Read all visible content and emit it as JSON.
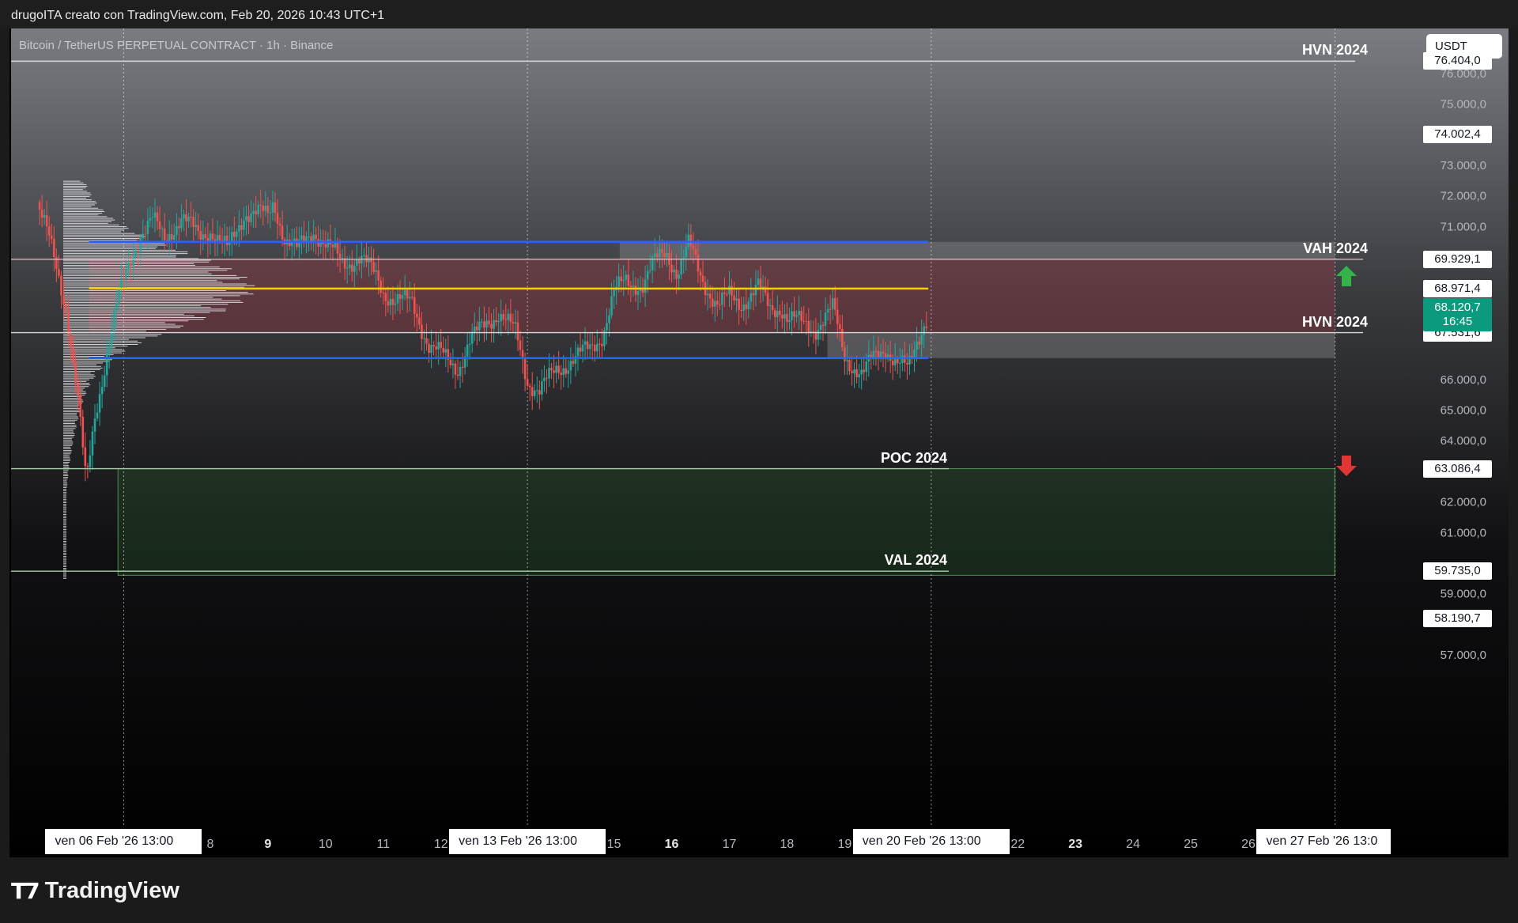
{
  "header": {
    "text": "drugoITA creato con TradingView.com, Feb 20, 2026 10:43 UTC+1"
  },
  "symbol": "Bitcoin / TetherUS PERPETUAL CONTRACT · 1h · Binance",
  "currency": "USDT",
  "brand": "TradingView",
  "colors": {
    "up": "#26a69a",
    "down": "#ef5350",
    "current": "#0c9a7e",
    "blue_line": "#2962ff",
    "yellow_line": "#f5d000",
    "arrow_up": "#34b34a",
    "arrow_down": "#e23636"
  },
  "chart_data": {
    "type": "candlestick",
    "timeframe": "1h",
    "ylim": [
      56000,
      77800
    ],
    "y_ticks": [
      "76.000,0",
      "75.000,0",
      "73.000,0",
      "72.000,0",
      "71.000,0",
      "66.000,0",
      "65.000,0",
      "64.000,0",
      "62.000,0",
      "61.000,0",
      "59.000,0",
      "57.000,0"
    ],
    "y_tick_values": [
      76000,
      75000,
      73000,
      72000,
      71000,
      66000,
      65000,
      64000,
      62000,
      61000,
      59000,
      57000
    ],
    "x_ticks": [
      {
        "label": "8",
        "day": 8
      },
      {
        "label": "9",
        "day": 9
      },
      {
        "label": "10",
        "day": 10
      },
      {
        "label": "11",
        "day": 11
      },
      {
        "label": "12",
        "day": 12
      },
      {
        "label": "15",
        "day": 15
      },
      {
        "label": "16",
        "day": 16
      },
      {
        "label": "17",
        "day": 17
      },
      {
        "label": "18",
        "day": 18
      },
      {
        "label": "19",
        "day": 19
      },
      {
        "label": "22",
        "day": 22
      },
      {
        "label": "23",
        "day": 23
      },
      {
        "label": "24",
        "day": 24
      },
      {
        "label": "25",
        "day": 25
      },
      {
        "label": "26",
        "day": 26
      }
    ],
    "x_date_labels": [
      {
        "text": "ven 06 Feb '26   13:00",
        "day": 6.5
      },
      {
        "text": "ven 13 Feb '26   13:00",
        "day": 13.5
      },
      {
        "text": "ven 20 Feb '26   13:00",
        "day": 20.5
      },
      {
        "text": "ven 27 Feb '26   13:0",
        "day": 27.5
      }
    ],
    "price_labels": [
      {
        "text": "76.404,0",
        "value": 76404
      },
      {
        "text": "74.002,4",
        "value": 74002.4
      },
      {
        "text": "69.929,1",
        "value": 69929.1
      },
      {
        "text": "68.971,4",
        "value": 68971.4
      },
      {
        "text": "67.531,6",
        "value": 67531.6
      },
      {
        "text": "63.086,4",
        "value": 63086.4
      },
      {
        "text": "59.735,0",
        "value": 59735
      },
      {
        "text": "58.190,7",
        "value": 58190.7
      }
    ],
    "current_price": {
      "price": "68.120,7",
      "countdown": "16:45",
      "value": 68120.7
    },
    "levels": [
      {
        "label": "HVN 2024",
        "value": 76404
      },
      {
        "label": "VAH 2024",
        "value": 69929.1
      },
      {
        "label": "HVN 2024",
        "value": 67531.6
      },
      {
        "label": "POC 2024",
        "value": 63086.4
      },
      {
        "label": "VAL 2024",
        "value": 59735
      }
    ],
    "day_range": [
      5.0,
      27.6
    ],
    "trend_lines": {
      "blue_top": 70500,
      "blue_bottom": 66700,
      "yellow": 68971.4,
      "blue_start_day": 5.9,
      "blue_end_day": 20.45
    },
    "zones": [
      {
        "type": "red",
        "from": 67531.6,
        "to": 69929.1,
        "start_day": 5.9,
        "end_day": 27.5
      },
      {
        "type": "gray",
        "from": 69929.1,
        "to": 70500,
        "start_day": 15.1,
        "end_day": 27.5
      },
      {
        "type": "gray",
        "from": 66700,
        "to": 67531.6,
        "start_day": 18.7,
        "end_day": 27.5
      },
      {
        "type": "green",
        "from": 59600,
        "to": 63086.4,
        "start_day": 6.4,
        "end_day": 27.5
      }
    ],
    "price_path": [
      [
        5.0,
        71800
      ],
      [
        5.2,
        70600
      ],
      [
        5.5,
        68400
      ],
      [
        5.7,
        65500
      ],
      [
        5.85,
        62500
      ],
      [
        6.0,
        64800
      ],
      [
        6.2,
        66800
      ],
      [
        6.4,
        68600
      ],
      [
        6.6,
        69800
      ],
      [
        6.8,
        70800
      ],
      [
        7.0,
        71200
      ],
      [
        7.2,
        70600
      ],
      [
        7.5,
        71300
      ],
      [
        7.8,
        70700
      ],
      [
        8.0,
        70900
      ],
      [
        8.3,
        70200
      ],
      [
        8.6,
        71500
      ],
      [
        8.9,
        71400
      ],
      [
        9.0,
        71300
      ],
      [
        9.1,
        71800
      ],
      [
        9.3,
        70600
      ],
      [
        9.5,
        70200
      ],
      [
        9.8,
        70900
      ],
      [
        10.0,
        70400
      ],
      [
        10.3,
        69800
      ],
      [
        10.6,
        70000
      ],
      [
        10.9,
        69300
      ],
      [
        11.0,
        68900
      ],
      [
        11.2,
        68600
      ],
      [
        11.5,
        68500
      ],
      [
        11.8,
        67100
      ],
      [
        12.0,
        66800
      ],
      [
        12.3,
        66400
      ],
      [
        12.5,
        67200
      ],
      [
        12.8,
        67900
      ],
      [
        13.0,
        68200
      ],
      [
        13.3,
        67500
      ],
      [
        13.5,
        66000
      ],
      [
        13.7,
        65600
      ],
      [
        14.0,
        66300
      ],
      [
        14.3,
        66700
      ],
      [
        14.6,
        67000
      ],
      [
        14.8,
        67500
      ],
      [
        15.0,
        68800
      ],
      [
        15.2,
        69200
      ],
      [
        15.5,
        69100
      ],
      [
        15.7,
        69800
      ],
      [
        15.9,
        70200
      ],
      [
        16.1,
        69500
      ],
      [
        16.3,
        70400
      ],
      [
        16.5,
        69400
      ],
      [
        16.8,
        68400
      ],
      [
        17.0,
        68700
      ],
      [
        17.2,
        68500
      ],
      [
        17.5,
        69000
      ],
      [
        17.7,
        68300
      ],
      [
        17.9,
        68400
      ],
      [
        18.0,
        68000
      ],
      [
        18.3,
        67800
      ],
      [
        18.5,
        67700
      ],
      [
        18.8,
        68300
      ],
      [
        19.0,
        66800
      ],
      [
        19.3,
        66100
      ],
      [
        19.5,
        66700
      ],
      [
        19.7,
        67100
      ],
      [
        19.9,
        66500
      ],
      [
        20.1,
        66300
      ],
      [
        20.2,
        67000
      ],
      [
        20.35,
        67800
      ],
      [
        20.45,
        68120.7
      ]
    ],
    "volume_profile": {
      "description": "horizontal volume bars on left, peak near 68971",
      "price_range": [
        59500,
        72500
      ],
      "peak_value": 68971.4
    }
  }
}
